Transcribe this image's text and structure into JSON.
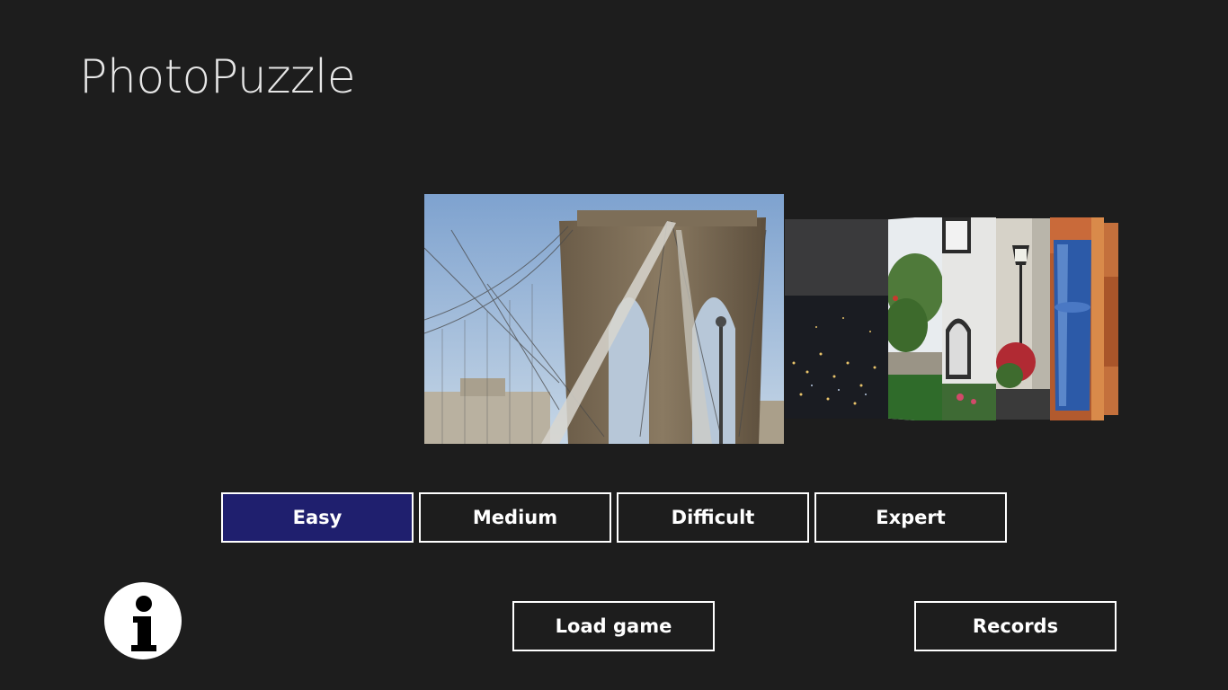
{
  "app": {
    "title": "PhotoPuzzle"
  },
  "carousel": {
    "photos": [
      {
        "name": "bridge-photo",
        "subject": "suspension bridge tower"
      },
      {
        "name": "city-night-photo",
        "subject": "city at night"
      },
      {
        "name": "garden-photo",
        "subject": "garden with pond"
      },
      {
        "name": "building-photo",
        "subject": "white building with window"
      },
      {
        "name": "street-lamp-photo",
        "subject": "street lamp and flowers"
      },
      {
        "name": "glass-photo",
        "subject": "blue glass"
      }
    ]
  },
  "difficulty": {
    "selected": "Easy",
    "options": [
      "Easy",
      "Medium",
      "Difficult",
      "Expert"
    ]
  },
  "actions": {
    "load_game": "Load game",
    "records": "Records"
  },
  "icons": {
    "info": "info-icon"
  },
  "colors": {
    "background": "#1d1d1d",
    "selected_button": "#1f1f6e",
    "button_border": "#ffffff",
    "text": "#ffffff"
  }
}
